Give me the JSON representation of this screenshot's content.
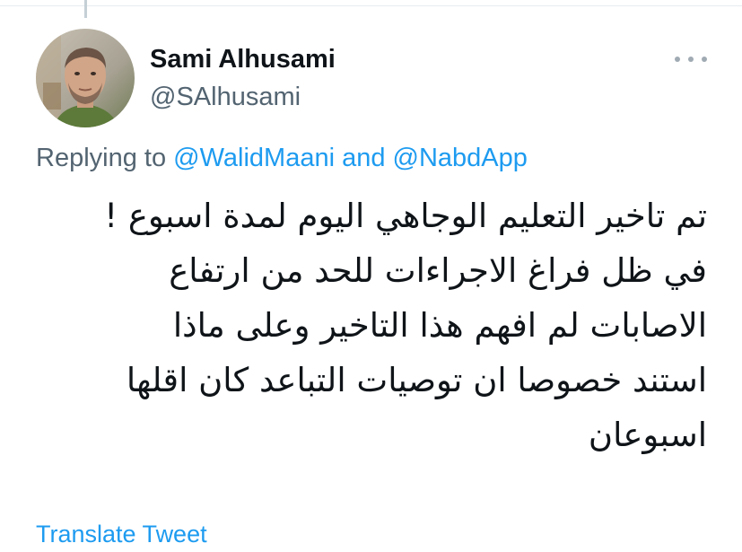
{
  "tweet": {
    "author": {
      "display_name": "Sami Alhusami",
      "handle": "@SAlhusami",
      "avatar_icon": "user-photo-avatar"
    },
    "more_icon": "more-horizontal-icon",
    "replying": {
      "prefix": "Replying to ",
      "mention_1": "@WalidMaani",
      "conjunction": " and ",
      "mention_2": "@NabdApp"
    },
    "text_lines": [
      "تم تاخير التعليم الوجاهي اليوم لمدة اسبوع !",
      "في ظل فراغ الاجراءات للحد من ارتفاع",
      "الاصابات لم افهم هذا التاخير وعلى ماذا",
      "استند خصوصا ان توصيات التباعد كان اقلها",
      "اسبوعان"
    ],
    "translate_label": "Translate Tweet"
  },
  "colors": {
    "text_primary": "#0f1419",
    "text_secondary": "#536471",
    "link": "#1d9bf0",
    "divider": "#e6ecf0"
  }
}
